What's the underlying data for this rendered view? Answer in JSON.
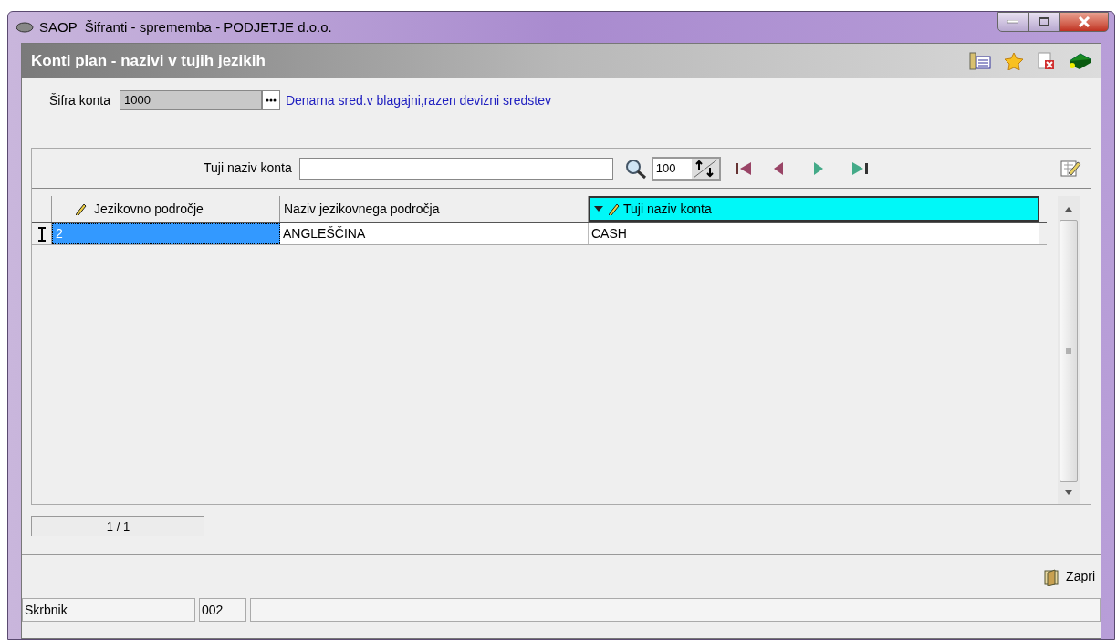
{
  "window": {
    "title": "SAOP  Šifranti - sprememba - PODJETJE d.o.o."
  },
  "form": {
    "title": "Konti plan - nazivi v tujih jezikih"
  },
  "account": {
    "label": "Šifra konta",
    "value": "1000",
    "description": "Denarna sred.v blagajni,razen devizni sredstev"
  },
  "search": {
    "label": "Tuji naziv konta",
    "page_size": "100"
  },
  "table": {
    "columns": [
      {
        "label": "Jezikovno področje",
        "editable": true,
        "sorted": false
      },
      {
        "label": "Naziv jezikovnega področja",
        "editable": false,
        "sorted": false
      },
      {
        "label": "Tuji naziv konta",
        "editable": true,
        "sorted": true
      }
    ],
    "rows": [
      {
        "cells": [
          {
            "text": "2",
            "selected": true
          },
          {
            "text": "ANGLEŠČINA",
            "selected": false
          },
          {
            "text": "CASH",
            "selected": false
          }
        ]
      }
    ]
  },
  "record_counter": "1 / 1",
  "close_button": "Zapri",
  "status_bar": [
    "Skrbnik",
    "002"
  ]
}
